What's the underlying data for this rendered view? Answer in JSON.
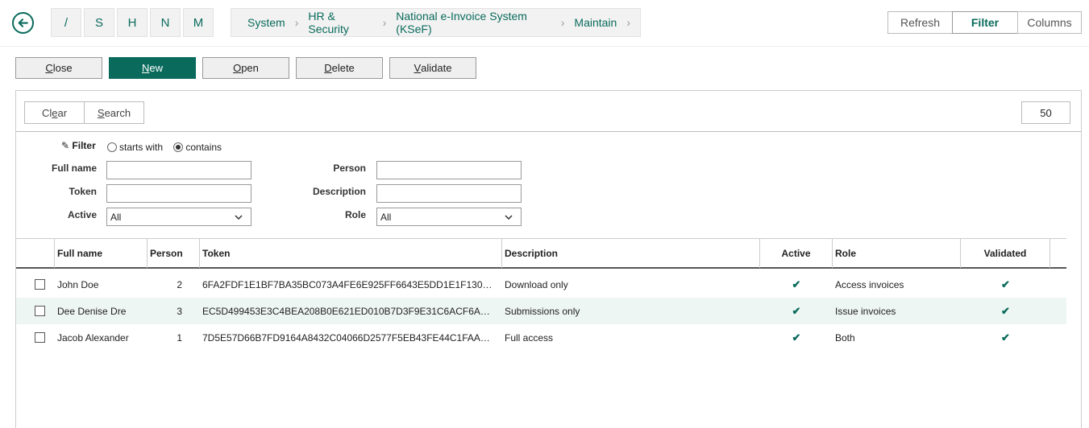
{
  "shortcuts": [
    "/",
    "S",
    "H",
    "N",
    "M"
  ],
  "breadcrumb": [
    "System",
    "HR & Security",
    "National e-Invoice System (KSeF)",
    "Maintain"
  ],
  "top_actions": {
    "refresh": "Refresh",
    "filter": "Filter",
    "columns": "Columns"
  },
  "actions": {
    "close": {
      "pre": "",
      "u": "C",
      "post": "lose"
    },
    "new": {
      "pre": "",
      "u": "N",
      "post": "ew"
    },
    "open": {
      "pre": "",
      "u": "O",
      "post": "pen"
    },
    "delete": {
      "pre": "",
      "u": "D",
      "post": "elete"
    },
    "validate": {
      "pre": "",
      "u": "V",
      "post": "alidate"
    }
  },
  "panel": {
    "clear": {
      "pre": "Cl",
      "u": "e",
      "post": "ar"
    },
    "search": {
      "pre": "",
      "u": "S",
      "post": "earch"
    },
    "page_size": "50"
  },
  "filter": {
    "label": "Filter",
    "mode_starts": "starts with",
    "mode_contains": "contains",
    "full_name_label": "Full name",
    "token_label": "Token",
    "active_label": "Active",
    "active_value": "All",
    "person_label": "Person",
    "description_label": "Description",
    "role_label": "Role",
    "role_value": "All"
  },
  "columns": [
    "Full name",
    "Person",
    "Token",
    "Description",
    "Active",
    "Role",
    "Validated"
  ],
  "rows": [
    {
      "full_name": "John Doe",
      "person": "2",
      "token": "6FA2FDF1E1BF7BA35BC073A4FE6E925FF6643E5DD1E1F130…",
      "description": "Download only",
      "active": "✔",
      "role": "Access invoices",
      "validated": "✔"
    },
    {
      "full_name": "Dee Denise Dre",
      "person": "3",
      "token": "EC5D499453E3C4BEA208B0E621ED010B7D3F9E31C6ACF6A…",
      "description": "Submissions only",
      "active": "✔",
      "role": "Issue invoices",
      "validated": "✔"
    },
    {
      "full_name": "Jacob Alexander",
      "person": "1",
      "token": "7D5E57D66B7FD9164A8432C04066D2577F5EB43FE44C1FAA…",
      "description": "Full access",
      "active": "✔",
      "role": "Both",
      "validated": "✔"
    }
  ],
  "colors": {
    "accent": "#0a6b5c",
    "row_alt": "#eef6f3"
  }
}
